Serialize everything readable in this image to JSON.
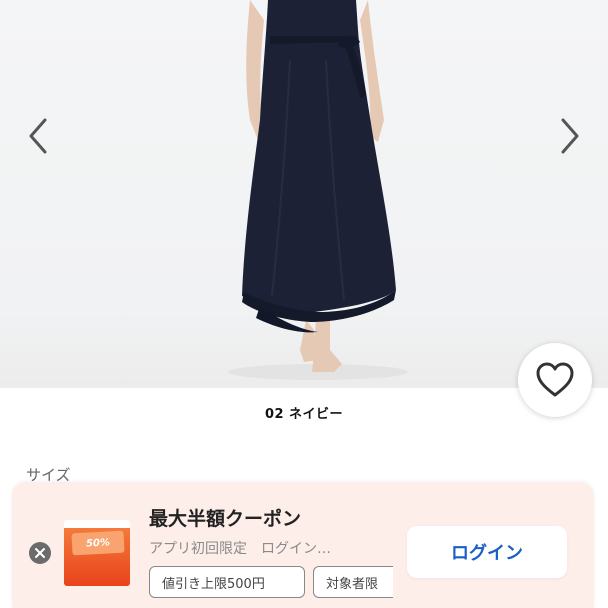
{
  "product": {
    "color_label": "02 ネイビー",
    "size_heading": "サイズ"
  },
  "banner": {
    "title": "最大半額クーポン",
    "subtitle": "アプリ初回限定　ログイン…",
    "coupon_badge": "50%",
    "chips": [
      "値引き上限500円",
      "対象者限"
    ],
    "login_label": "ログイン"
  },
  "icons": {
    "prev": "chevron-left-icon",
    "next": "chevron-right-icon",
    "favorite": "heart-icon",
    "close": "close-icon"
  },
  "colors": {
    "dress": "#1c2135",
    "login_text": "#1a5fc8",
    "banner_bg": "#fdeee9",
    "coupon_orange": "#e8431b"
  }
}
